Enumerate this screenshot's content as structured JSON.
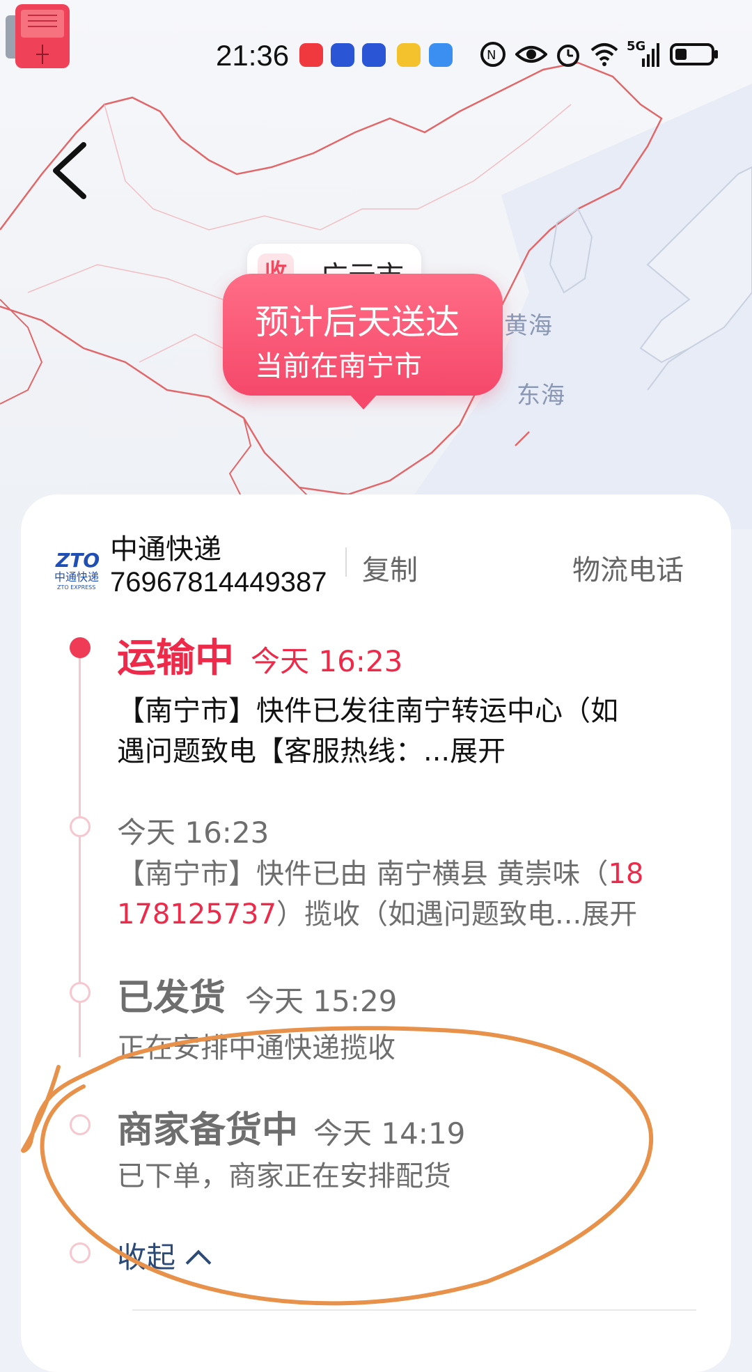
{
  "status_bar": {
    "time": "21:36",
    "network": "5G"
  },
  "map": {
    "sea_labels": [
      "黄海",
      "东海"
    ],
    "city_chip": {
      "badge": "收",
      "city": "广元市"
    },
    "bubble": {
      "line1": "预计后天送达",
      "line2": "当前在南宁市"
    }
  },
  "carrier": {
    "name": "中通快递",
    "tracking_number": "76967814449387",
    "copy_label": "复制",
    "phone_label": "物流电话"
  },
  "timeline": [
    {
      "status": "运输中",
      "time": "今天 16:23",
      "desc_line1": "【南宁市】快件已发往南宁转运中心（如",
      "desc_line2": "遇问题致电【客服热线：...展开"
    },
    {
      "status": "",
      "time": "今天 16:23",
      "desc_line1_a": "【南宁市】快件已由 南宁横县 黄崇味（",
      "desc_line1_b": "18",
      "desc_line2_a": "178125737",
      "desc_line2_b": "）揽收（如遇问题致电...展开"
    },
    {
      "status": "已发货",
      "time": "今天 15:29",
      "desc": "正在安排中通快递揽收"
    },
    {
      "status": "商家备货中",
      "time": "今天 14:19",
      "desc": "已下单，商家正在安排配货"
    }
  ],
  "collapse_label": "收起",
  "colors": {
    "accent": "#ee2a4a",
    "link": "#2c4a78",
    "annotation": "#e8914a"
  }
}
